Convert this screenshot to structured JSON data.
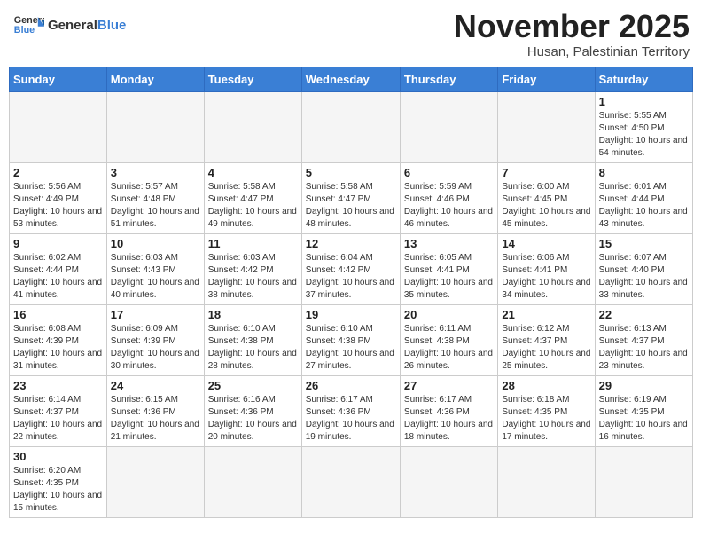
{
  "header": {
    "logo_general": "General",
    "logo_blue": "Blue",
    "month_title": "November 2025",
    "location": "Husan, Palestinian Territory"
  },
  "weekdays": [
    "Sunday",
    "Monday",
    "Tuesday",
    "Wednesday",
    "Thursday",
    "Friday",
    "Saturday"
  ],
  "weeks": [
    [
      {
        "day": "",
        "info": ""
      },
      {
        "day": "",
        "info": ""
      },
      {
        "day": "",
        "info": ""
      },
      {
        "day": "",
        "info": ""
      },
      {
        "day": "",
        "info": ""
      },
      {
        "day": "",
        "info": ""
      },
      {
        "day": "1",
        "info": "Sunrise: 5:55 AM\nSunset: 4:50 PM\nDaylight: 10 hours\nand 54 minutes."
      }
    ],
    [
      {
        "day": "2",
        "info": "Sunrise: 5:56 AM\nSunset: 4:49 PM\nDaylight: 10 hours\nand 53 minutes."
      },
      {
        "day": "3",
        "info": "Sunrise: 5:57 AM\nSunset: 4:48 PM\nDaylight: 10 hours\nand 51 minutes."
      },
      {
        "day": "4",
        "info": "Sunrise: 5:58 AM\nSunset: 4:47 PM\nDaylight: 10 hours\nand 49 minutes."
      },
      {
        "day": "5",
        "info": "Sunrise: 5:58 AM\nSunset: 4:47 PM\nDaylight: 10 hours\nand 48 minutes."
      },
      {
        "day": "6",
        "info": "Sunrise: 5:59 AM\nSunset: 4:46 PM\nDaylight: 10 hours\nand 46 minutes."
      },
      {
        "day": "7",
        "info": "Sunrise: 6:00 AM\nSunset: 4:45 PM\nDaylight: 10 hours\nand 45 minutes."
      },
      {
        "day": "8",
        "info": "Sunrise: 6:01 AM\nSunset: 4:44 PM\nDaylight: 10 hours\nand 43 minutes."
      }
    ],
    [
      {
        "day": "9",
        "info": "Sunrise: 6:02 AM\nSunset: 4:44 PM\nDaylight: 10 hours\nand 41 minutes."
      },
      {
        "day": "10",
        "info": "Sunrise: 6:03 AM\nSunset: 4:43 PM\nDaylight: 10 hours\nand 40 minutes."
      },
      {
        "day": "11",
        "info": "Sunrise: 6:03 AM\nSunset: 4:42 PM\nDaylight: 10 hours\nand 38 minutes."
      },
      {
        "day": "12",
        "info": "Sunrise: 6:04 AM\nSunset: 4:42 PM\nDaylight: 10 hours\nand 37 minutes."
      },
      {
        "day": "13",
        "info": "Sunrise: 6:05 AM\nSunset: 4:41 PM\nDaylight: 10 hours\nand 35 minutes."
      },
      {
        "day": "14",
        "info": "Sunrise: 6:06 AM\nSunset: 4:41 PM\nDaylight: 10 hours\nand 34 minutes."
      },
      {
        "day": "15",
        "info": "Sunrise: 6:07 AM\nSunset: 4:40 PM\nDaylight: 10 hours\nand 33 minutes."
      }
    ],
    [
      {
        "day": "16",
        "info": "Sunrise: 6:08 AM\nSunset: 4:39 PM\nDaylight: 10 hours\nand 31 minutes."
      },
      {
        "day": "17",
        "info": "Sunrise: 6:09 AM\nSunset: 4:39 PM\nDaylight: 10 hours\nand 30 minutes."
      },
      {
        "day": "18",
        "info": "Sunrise: 6:10 AM\nSunset: 4:38 PM\nDaylight: 10 hours\nand 28 minutes."
      },
      {
        "day": "19",
        "info": "Sunrise: 6:10 AM\nSunset: 4:38 PM\nDaylight: 10 hours\nand 27 minutes."
      },
      {
        "day": "20",
        "info": "Sunrise: 6:11 AM\nSunset: 4:38 PM\nDaylight: 10 hours\nand 26 minutes."
      },
      {
        "day": "21",
        "info": "Sunrise: 6:12 AM\nSunset: 4:37 PM\nDaylight: 10 hours\nand 25 minutes."
      },
      {
        "day": "22",
        "info": "Sunrise: 6:13 AM\nSunset: 4:37 PM\nDaylight: 10 hours\nand 23 minutes."
      }
    ],
    [
      {
        "day": "23",
        "info": "Sunrise: 6:14 AM\nSunset: 4:37 PM\nDaylight: 10 hours\nand 22 minutes."
      },
      {
        "day": "24",
        "info": "Sunrise: 6:15 AM\nSunset: 4:36 PM\nDaylight: 10 hours\nand 21 minutes."
      },
      {
        "day": "25",
        "info": "Sunrise: 6:16 AM\nSunset: 4:36 PM\nDaylight: 10 hours\nand 20 minutes."
      },
      {
        "day": "26",
        "info": "Sunrise: 6:17 AM\nSunset: 4:36 PM\nDaylight: 10 hours\nand 19 minutes."
      },
      {
        "day": "27",
        "info": "Sunrise: 6:17 AM\nSunset: 4:36 PM\nDaylight: 10 hours\nand 18 minutes."
      },
      {
        "day": "28",
        "info": "Sunrise: 6:18 AM\nSunset: 4:35 PM\nDaylight: 10 hours\nand 17 minutes."
      },
      {
        "day": "29",
        "info": "Sunrise: 6:19 AM\nSunset: 4:35 PM\nDaylight: 10 hours\nand 16 minutes."
      }
    ],
    [
      {
        "day": "30",
        "info": "Sunrise: 6:20 AM\nSunset: 4:35 PM\nDaylight: 10 hours\nand 15 minutes."
      },
      {
        "day": "",
        "info": ""
      },
      {
        "day": "",
        "info": ""
      },
      {
        "day": "",
        "info": ""
      },
      {
        "day": "",
        "info": ""
      },
      {
        "day": "",
        "info": ""
      },
      {
        "day": "",
        "info": ""
      }
    ]
  ]
}
